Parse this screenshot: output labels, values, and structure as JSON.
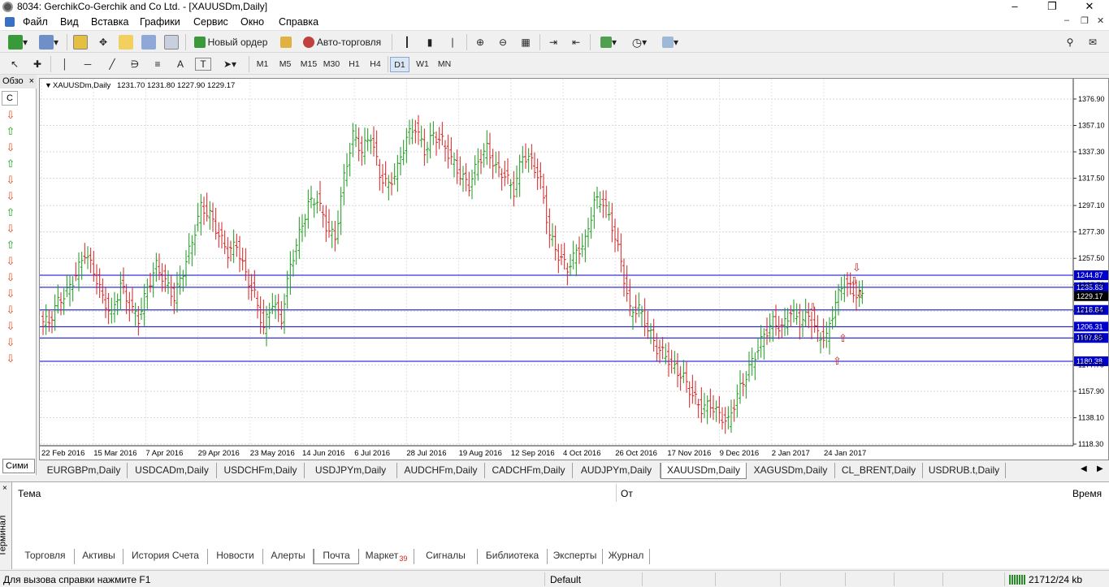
{
  "window": {
    "title": "8034: GerchikCo-Gerchik and Co Ltd. - [XAUUSDm,Daily]"
  },
  "menu": [
    "Файл",
    "Вид",
    "Вставка",
    "Графики",
    "Сервис",
    "Окно",
    "Справка"
  ],
  "toolbar": {
    "new_order": "Новый ордер",
    "autotrading": "Авто-торговля"
  },
  "drawing_tools": [
    "A",
    "T"
  ],
  "timeframes": [
    "M1",
    "M5",
    "M15",
    "M30",
    "H1",
    "H4",
    "D1",
    "W1",
    "MN"
  ],
  "active_timeframe": "D1",
  "left_panel": {
    "title": "Обзо",
    "column": "С",
    "tab": "Сими",
    "arrows": [
      "down",
      "up",
      "down",
      "up",
      "down",
      "down",
      "up",
      "down",
      "up",
      "down",
      "down",
      "down",
      "down",
      "down",
      "down",
      "down"
    ]
  },
  "chart_data": {
    "type": "ohlc",
    "symbol_label": "XAUUSDm,Daily",
    "ohlc_label": "1231.70 1231.80 1227.90 1229.17",
    "current_price": "1229.17",
    "y_ticks": [
      "1376.90",
      "1357.10",
      "1337.30",
      "1317.50",
      "1297.10",
      "1277.30",
      "1257.50",
      "1237.70",
      "1217.90",
      "1197.86",
      "1177.70",
      "1157.90",
      "1138.10",
      "1118.30"
    ],
    "x_ticks": [
      "22 Feb 2016",
      "15 Mar 2016",
      "7 Apr 2016",
      "29 Apr 2016",
      "23 May 2016",
      "14 Jun 2016",
      "6 Jul 2016",
      "28 Jul 2016",
      "19 Aug 2016",
      "12 Sep 2016",
      "4 Oct 2016",
      "26 Oct 2016",
      "17 Nov 2016",
      "9 Dec 2016",
      "2 Jan 2017",
      "24 Jan 2017"
    ],
    "ylim": [
      1118.3,
      1386
    ],
    "levels": [
      {
        "value": 1244.87,
        "label": "1244.87"
      },
      {
        "value": 1235.83,
        "label": "1235.83"
      },
      {
        "value": 1218.84,
        "label": "1218.84"
      },
      {
        "value": 1206.31,
        "label": "1206.31"
      },
      {
        "value": 1197.86,
        "label": "1197.86"
      },
      {
        "value": 1180.38,
        "label": "1180.38"
      }
    ],
    "closes": [
      1210,
      1225,
      1232,
      1245,
      1262,
      1248,
      1228,
      1215,
      1238,
      1222,
      1212,
      1235,
      1252,
      1240,
      1228,
      1248,
      1270,
      1296,
      1290,
      1275,
      1262,
      1268,
      1245,
      1230,
      1205,
      1225,
      1212,
      1252,
      1275,
      1298,
      1302,
      1282,
      1272,
      1318,
      1350,
      1338,
      1350,
      1320,
      1312,
      1325,
      1348,
      1356,
      1338,
      1350,
      1345,
      1332,
      1320,
      1312,
      1330,
      1340,
      1325,
      1320,
      1308,
      1335,
      1330,
      1315,
      1275,
      1260,
      1250,
      1262,
      1270,
      1300,
      1300,
      1282,
      1255,
      1218,
      1220,
      1205,
      1190,
      1185,
      1175,
      1168,
      1155,
      1145,
      1148,
      1140,
      1135,
      1155,
      1170,
      1185,
      1200,
      1210,
      1205,
      1218,
      1210,
      1215,
      1200,
      1198,
      1225,
      1240,
      1232,
      1229
    ]
  },
  "chart_tabs": [
    "EURGBPm,Daily",
    "USDCADm,Daily",
    "USDCHFm,Daily",
    "USDJPYm,Daily",
    "AUDCHFm,Daily",
    "CADCHFm,Daily",
    "AUDJPYm,Daily",
    "XAUUSDm,Daily",
    "XAGUSDm,Daily",
    "CL_BRENT,Daily",
    "USDRUB.t,Daily"
  ],
  "active_chart_tab": "XAUUSDm,Daily",
  "terminal": {
    "side_label": "Терминал",
    "columns": [
      "Тема",
      "От",
      "Время"
    ],
    "tabs": [
      "Торговля",
      "Активы",
      "История Счета",
      "Новости",
      "Алерты",
      "Почта",
      "Маркет",
      "Сигналы",
      "Библиотека",
      "Эксперты",
      "Журнал"
    ],
    "active_tab": "Почта",
    "market_badge": "39"
  },
  "status": {
    "help": "Для вызова справки нажмите F1",
    "profile": "Default",
    "traffic": "21712/24 kb"
  },
  "colors": {
    "bull": "#1a9a1a",
    "bear": "#d42020",
    "level": "#0000cc",
    "label_bg": "#0000cc"
  }
}
